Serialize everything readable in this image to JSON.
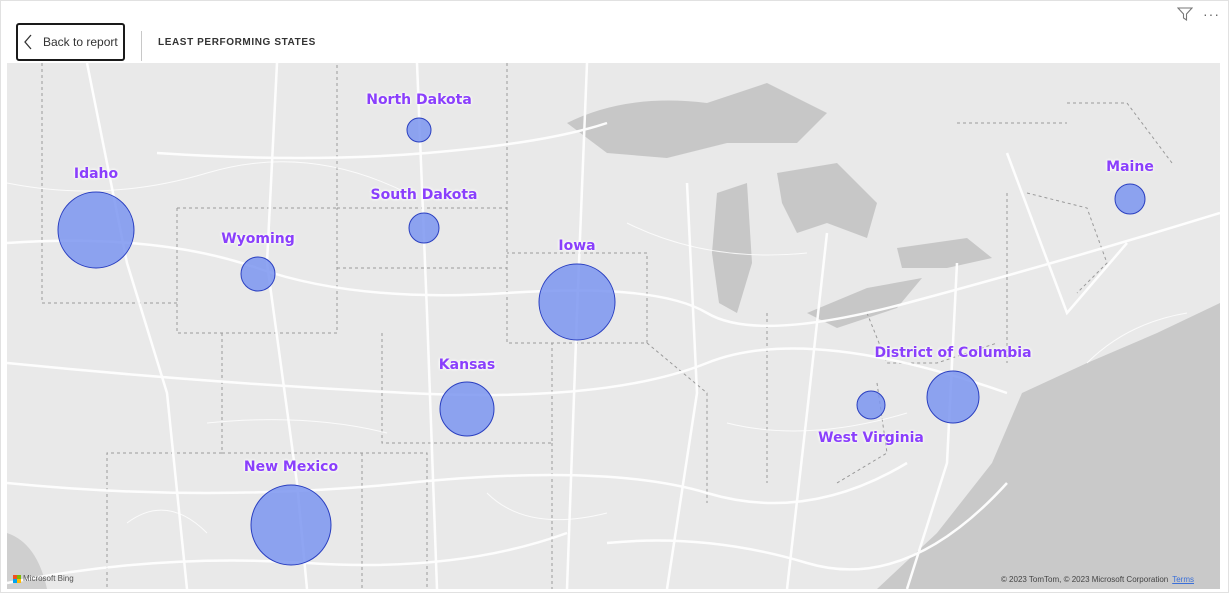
{
  "toolbar": {
    "back_label": "Back to report",
    "page_title": "LEAST PERFORMING STATES",
    "filter_icon": "filter-icon",
    "more_icon": "more-options-icon",
    "more_glyph": "···"
  },
  "map": {
    "bubble_color": "#7b95f0",
    "bubble_stroke": "#2a3fc0",
    "label_color": "#8a3ffc",
    "bubbles": [
      {
        "state": "North Dakota"
      },
      {
        "state": "Idaho"
      },
      {
        "state": "South Dakota"
      },
      {
        "state": "Wyoming"
      },
      {
        "state": "Iowa"
      },
      {
        "state": "Maine"
      },
      {
        "state": "Kansas"
      },
      {
        "state": "District of Columbia"
      },
      {
        "state": "West Virginia"
      },
      {
        "state": "New Mexico"
      }
    ],
    "logo_text": "Microsoft Bing",
    "attribution": "© 2023 TomTom, © 2023 Microsoft Corporation",
    "terms_label": "Terms"
  }
}
